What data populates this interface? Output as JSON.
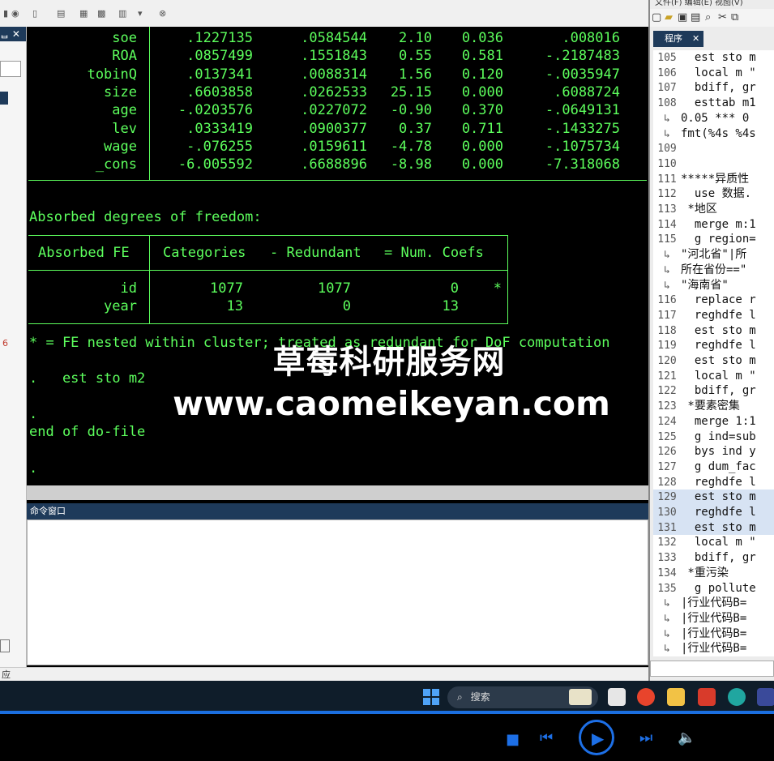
{
  "results": {
    "coef_rows": [
      {
        "var": "soe",
        "coef": ".1227135",
        "se": ".0584544",
        "t": "2.10",
        "p": "0.036",
        "ci": ".008016"
      },
      {
        "var": "ROA",
        "coef": ".0857499",
        "se": ".1551843",
        "t": "0.55",
        "p": "0.581",
        "ci": "-.2187483"
      },
      {
        "var": "tobinQ",
        "coef": ".0137341",
        "se": ".0088314",
        "t": "1.56",
        "p": "0.120",
        "ci": "-.0035947"
      },
      {
        "var": "size",
        "coef": ".6603858",
        "se": ".0262533",
        "t": "25.15",
        "p": "0.000",
        "ci": ".6088724"
      },
      {
        "var": "age",
        "coef": "-.0203576",
        "se": ".0227072",
        "t": "-0.90",
        "p": "0.370",
        "ci": "-.0649131"
      },
      {
        "var": "lev",
        "coef": ".0333419",
        "se": ".0900377",
        "t": "0.37",
        "p": "0.711",
        "ci": "-.1433275"
      },
      {
        "var": "wage",
        "coef": "-.076255",
        "se": ".0159611",
        "t": "-4.78",
        "p": "0.000",
        "ci": "-.1075734"
      },
      {
        "var": "_cons",
        "coef": "-6.005592",
        "se": ".6688896",
        "t": "-8.98",
        "p": "0.000",
        "ci": "-7.318068"
      }
    ],
    "absorbed_title": "Absorbed degrees of freedom:",
    "fe_header": {
      "col1": "Absorbed FE",
      "col2": "Categories",
      "col3": "- Redundant",
      "col4": "= Num. Coefs"
    },
    "fe_rows": [
      {
        "name": "id",
        "categories": "1077",
        "redundant": "1077",
        "num": "0",
        "star": "*"
      },
      {
        "name": "year",
        "categories": "13",
        "redundant": "0",
        "num": "13",
        "star": ""
      }
    ],
    "nested_note": "* = FE nested within cluster; treated as redundant for DoF computation",
    "cmd_line": ".   est sto m2",
    "dot_line": ".",
    "end_line": "end of do-file",
    "prompt": "."
  },
  "command_window": {
    "title": "命令窗口"
  },
  "statusbar": {
    "text": "应"
  },
  "left_panel": {
    "header": "ᆸ ✕",
    "marker": "6"
  },
  "editor": {
    "menu": "文件(F)   编辑(E)   视图(V)",
    "tab_label": "程序",
    "tab_close": "✕",
    "lines": [
      {
        "num": "105",
        "text": "  est sto m",
        "hl": false
      },
      {
        "num": "106",
        "text": "  local m \"",
        "hl": false
      },
      {
        "num": "107",
        "text": "  bdiff, gr",
        "hl": false
      },
      {
        "num": "108",
        "text": "  esttab m1",
        "hl": false
      },
      {
        "num": "↳",
        "text": "0.05 *** 0",
        "hl": false
      },
      {
        "num": "↳",
        "text": "fmt(%4s %4s",
        "hl": false
      },
      {
        "num": "109",
        "text": "",
        "hl": false
      },
      {
        "num": "110",
        "text": "",
        "hl": false
      },
      {
        "num": "111",
        "text": "*****异质性",
        "hl": false
      },
      {
        "num": "112",
        "text": "  use 数据.",
        "hl": false
      },
      {
        "num": "113",
        "text": " *地区",
        "hl": false
      },
      {
        "num": "114",
        "text": "  merge m:1",
        "hl": false
      },
      {
        "num": "115",
        "text": "  g region=",
        "hl": false
      },
      {
        "num": "↳",
        "text": "\"河北省\"|所",
        "hl": false
      },
      {
        "num": "↳",
        "text": "所在省份==\"",
        "hl": false
      },
      {
        "num": "↳",
        "text": "\"海南省\"",
        "hl": false
      },
      {
        "num": "116",
        "text": "  replace r",
        "hl": false
      },
      {
        "num": "117",
        "text": "  reghdfe l",
        "hl": false
      },
      {
        "num": "118",
        "text": "  est sto m",
        "hl": false
      },
      {
        "num": "119",
        "text": "  reghdfe l",
        "hl": false
      },
      {
        "num": "120",
        "text": "  est sto m",
        "hl": false
      },
      {
        "num": "121",
        "text": "  local m \"",
        "hl": false
      },
      {
        "num": "122",
        "text": "  bdiff, gr",
        "hl": false
      },
      {
        "num": "123",
        "text": " *要素密集",
        "hl": false
      },
      {
        "num": "124",
        "text": "  merge 1:1",
        "hl": false
      },
      {
        "num": "125",
        "text": "  g ind=sub",
        "hl": false
      },
      {
        "num": "126",
        "text": "  bys ind y",
        "hl": false
      },
      {
        "num": "127",
        "text": "  g dum_fac",
        "hl": false
      },
      {
        "num": "128",
        "text": "  reghdfe l",
        "hl": false
      },
      {
        "num": "129",
        "text": "  est sto m",
        "hl": true
      },
      {
        "num": "130",
        "text": "  reghdfe l",
        "hl": true
      },
      {
        "num": "131",
        "text": "  est sto m",
        "hl": true
      },
      {
        "num": "132",
        "text": "  local m \"",
        "hl": false
      },
      {
        "num": "133",
        "text": "  bdiff, gr",
        "hl": false
      },
      {
        "num": "134",
        "text": " *重污染",
        "hl": false
      },
      {
        "num": "135",
        "text": "  g pollute",
        "hl": false
      },
      {
        "num": "↳",
        "text": "|行业代码B=",
        "hl": false
      },
      {
        "num": "↳",
        "text": "|行业代码B=",
        "hl": false
      },
      {
        "num": "↳",
        "text": "|行业代码B=",
        "hl": false
      },
      {
        "num": "↳",
        "text": "|行业代码B=",
        "hl": false
      }
    ]
  },
  "watermark": {
    "line1": "草莓科研服务网",
    "line2": "www.caomeikeyan.com"
  },
  "taskbar": {
    "search_placeholder": "搜索"
  },
  "media": {
    "stop": "■",
    "prev": "⏮",
    "play": "▶",
    "next": "⏭",
    "volume": "🔈"
  },
  "colors": {
    "results_text": "#5dff5d",
    "results_bg": "#000000",
    "accent_blue": "#1d6fe6",
    "pane_title": "#1e3a5a"
  }
}
